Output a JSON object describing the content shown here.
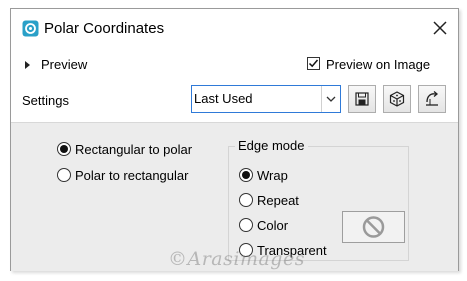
{
  "dialog": {
    "title": "Polar Coordinates",
    "preview_label": "Preview",
    "preview_on_image_label": "Preview on Image",
    "preview_on_image_checked": true,
    "settings_label": "Settings",
    "settings_value": "Last Used"
  },
  "conversion": {
    "options": [
      "Rectangular to polar",
      "Polar to rectangular"
    ],
    "selected": "Rectangular to polar"
  },
  "edge_mode": {
    "title": "Edge mode",
    "options": [
      "Wrap",
      "Repeat",
      "Color",
      "Transparent"
    ],
    "selected": "Wrap"
  },
  "watermark": "©Arasimages",
  "colors": {
    "accent": "#2f7ad8",
    "panel": "#ececec",
    "app_icon": "#2aa0c8"
  },
  "icons": [
    "app-icon",
    "close-icon",
    "chevron-right-icon",
    "save-icon",
    "cube-icon",
    "reset-icon",
    "no-color-icon",
    "dropdown-arrow-icon"
  ]
}
